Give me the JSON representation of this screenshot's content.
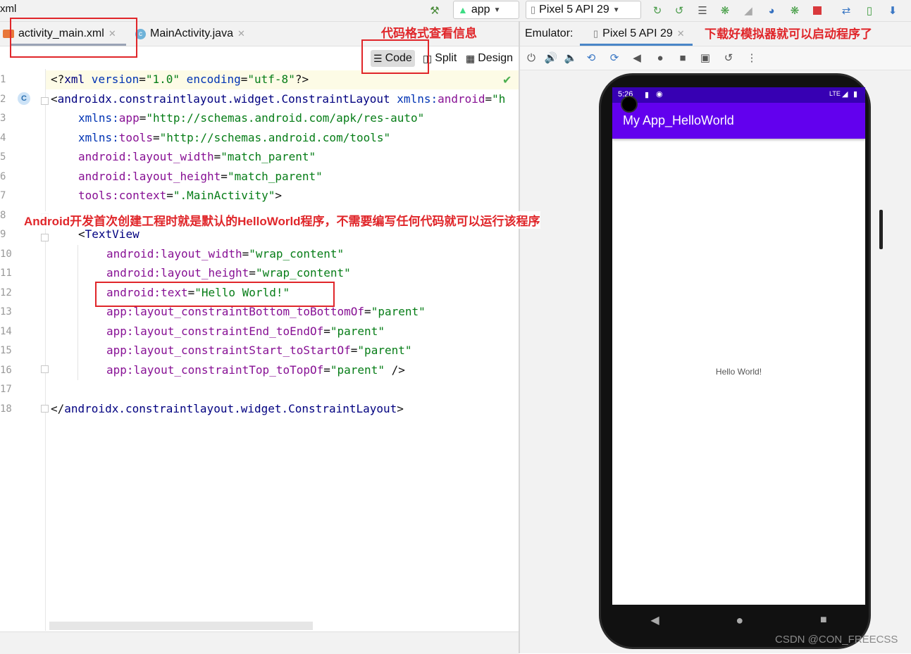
{
  "breadcrumb": "xml",
  "toolbar": {
    "run_config": "app",
    "device": "Pixel 5 API 29"
  },
  "editor_tabs": [
    {
      "label": "activity_main.xml",
      "active": true
    },
    {
      "label": "MainActivity.java",
      "active": false
    }
  ],
  "view_modes": {
    "code": "Code",
    "split": "Split",
    "design": "Design",
    "selected": "Code"
  },
  "emulator": {
    "label": "Emulator:",
    "device_tab": "Pixel 5 API 29"
  },
  "code": {
    "line_numbers": [
      "1",
      "2",
      "3",
      "4",
      "5",
      "6",
      "7",
      "8",
      "9",
      "10",
      "11",
      "12",
      "13",
      "14",
      "15",
      "16",
      "17",
      "18"
    ],
    "l1": {
      "p1": "<?",
      "t": "xml",
      "a1": " version",
      "eq1": "=",
      "s1": "\"1.0\"",
      "a2": " encoding",
      "eq2": "=",
      "s2": "\"utf-8\"",
      "p2": "?>"
    },
    "l2": {
      "p1": "<",
      "t": "androidx.constraintlayout.widget.ConstraintLayout",
      "ns": " xmlns:",
      "a": "android",
      "eq": "=",
      "s": "\"h"
    },
    "l3": {
      "ns": "xmlns:",
      "a": "app",
      "eq": "=",
      "s": "\"http://schemas.android.com/apk/res-auto\""
    },
    "l4": {
      "ns": "xmlns:",
      "a": "tools",
      "eq": "=",
      "s": "\"http://schemas.android.com/tools\""
    },
    "l5": {
      "ns": "android:",
      "a": "layout_width",
      "eq": "=",
      "s": "\"match_parent\""
    },
    "l6": {
      "ns": "android:",
      "a": "layout_height",
      "eq": "=",
      "s": "\"match_parent\""
    },
    "l7": {
      "ns": "tools:",
      "a": "context",
      "eq": "=",
      "s": "\".MainActivity\"",
      "p": ">"
    },
    "l9": {
      "p": "<",
      "t": "TextView"
    },
    "l10": {
      "ns": "android:",
      "a": "layout_width",
      "eq": "=",
      "s": "\"wrap_content\""
    },
    "l11": {
      "ns": "android:",
      "a": "layout_height",
      "eq": "=",
      "s": "\"wrap_content\""
    },
    "l12": {
      "ns": "android:",
      "a": "text",
      "eq": "=",
      "s": "\"Hello World!\""
    },
    "l13": {
      "ns": "app:",
      "a": "layout_constraintBottom_toBottomOf",
      "eq": "=",
      "s": "\"parent\""
    },
    "l14": {
      "ns": "app:",
      "a": "layout_constraintEnd_toEndOf",
      "eq": "=",
      "s": "\"parent\""
    },
    "l15": {
      "ns": "app:",
      "a": "layout_constraintStart_toStartOf",
      "eq": "=",
      "s": "\"parent\""
    },
    "l16": {
      "ns": "app:",
      "a": "layout_constraintTop_toTopOf",
      "eq": "=",
      "s": "\"parent\"",
      "p": " />"
    },
    "l18": {
      "p1": "</",
      "t": "androidx.constraintlayout.widget.ConstraintLayout",
      "p2": ">"
    }
  },
  "phone": {
    "status_time": "5:26",
    "status_network": "LTE",
    "app_title": "My App_HelloWorld",
    "content_text": "Hello World!"
  },
  "annotations": {
    "code_view_note": "代码格式查看信息",
    "emulator_note": "下载好模拟器就可以启动程序了",
    "main_note": "Android开发首次创建工程时就是默认的HelloWorld程序，不需要编写任何代码就可以运行该程序"
  },
  "watermark": "CSDN @CON_FREECSS",
  "colors": {
    "app_bar": "#6200ee",
    "status_bar": "#3700b3",
    "annotation": "#e0262a"
  }
}
